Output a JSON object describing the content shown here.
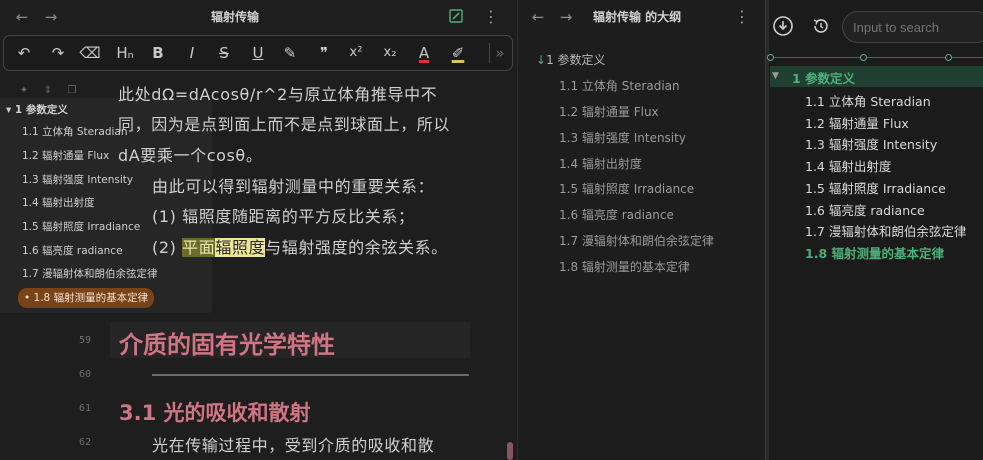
{
  "editor": {
    "title": "辐射传输",
    "toolbar": {
      "undo": "↶",
      "redo": "↷",
      "clear": "⌫",
      "heading": "Hₙ",
      "bold": "B",
      "italic": "I",
      "strike": "S",
      "underline": "U",
      "highlight_pen": "✎",
      "quote": "❞",
      "sup": "x²",
      "sub": "x₂",
      "font_color": "A",
      "bg_color": "✐",
      "more": "»"
    },
    "outline_popup": {
      "root": "▾ 1 参数定义",
      "items": [
        "1.1 立体角 Steradian",
        "1.2 辐射通量 Flux",
        "1.3 辐射强度 Intensity",
        "1.4 辐射出射度",
        "1.5 辐射照度 Irradiance",
        "1.6 辐亮度 radiance",
        "1.7 漫辐射体和朗伯余弦定律"
      ],
      "active": "• 1.8 辐射测量的基本定律"
    },
    "body": {
      "line1": "此处dΩ=dAcosθ/r^2与原立体角推导中不",
      "line2": "同，因为是点到面上而不是点到球面上，所以",
      "line3": "dA要乘一个cosθ。",
      "line4": "由此可以得到辐射测量中的重要关系：",
      "line5": "(1)   辐照度随距离的平方反比关系；",
      "line6_prefix": "(2)   ",
      "line6_hl1": "平面",
      "line6_hl2": "辐照度",
      "line6_rest": "与辐射强度的余弦关系。"
    },
    "line_numbers": [
      "59",
      "60",
      "61",
      "62"
    ],
    "heading1": "介质的固有光学特性",
    "heading2": "3.1 光的吸收和散射",
    "para": "光在传输过程中，受到介质的吸收和散"
  },
  "outline": {
    "title": "辐射传输 的大纲",
    "root": "1 参数定义",
    "items": [
      "1.1 立体角 Steradian",
      "1.2 辐射通量 Flux",
      "1.3 辐射强度 Intensity",
      "1.4 辐射出射度",
      "1.5 辐射照度 Irradiance",
      "1.6 辐亮度 radiance",
      "1.7 漫辐射体和朗伯余弦定律",
      "1.8 辐射测量的基本定律"
    ]
  },
  "sidebar": {
    "search_placeholder": "Input to search",
    "root": "1 参数定义",
    "items": [
      "1.1 立体角 Steradian",
      "1.2 辐射通量 Flux",
      "1.3 辐射强度 Intensity",
      "1.4 辐射出射度",
      "1.5 辐射照度 Irradiance",
      "1.6 辐亮度 radiance",
      "1.7 漫辐射体和朗伯余弦定律"
    ],
    "active": "1.8 辐射测量的基本定律"
  },
  "colors": {
    "accent_green": "#4caf7a",
    "heading_pink": "#d17484",
    "active_orange": "#7a4316"
  }
}
